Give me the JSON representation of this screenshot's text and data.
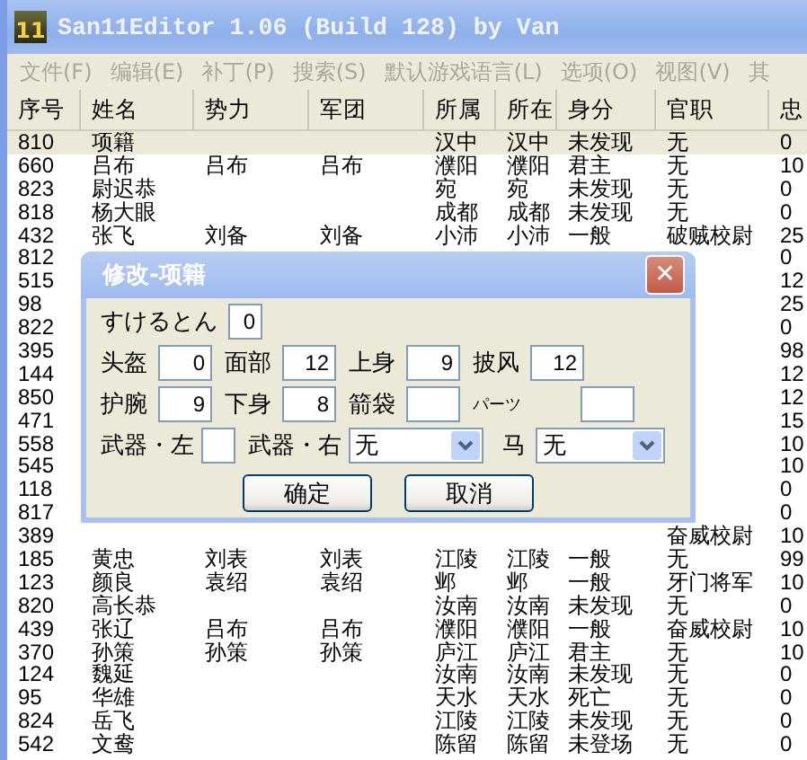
{
  "window": {
    "icon_label": "11",
    "title": "San11Editor 1.06 (Build 128) by Van"
  },
  "menu": [
    {
      "label": "文件(F)",
      "disabled": true
    },
    {
      "label": "编辑(E)",
      "disabled": true
    },
    {
      "label": "补丁(P)",
      "disabled": true
    },
    {
      "label": "搜索(S)",
      "disabled": true
    },
    {
      "label": "默认游戏语言(L)",
      "disabled": true
    },
    {
      "label": "选项(O)",
      "disabled": true
    },
    {
      "label": "视图(V)",
      "disabled": true
    },
    {
      "label": "其",
      "disabled": true
    }
  ],
  "table": {
    "columns": [
      "序号",
      "姓名",
      "势力",
      "军团",
      "所属",
      "所在",
      "身分",
      "官职",
      "忠"
    ],
    "rows": [
      {
        "selected": true,
        "id": "810",
        "name": "项籍",
        "belongs": "汉中",
        "location": "汉中",
        "status": "未发现",
        "rank": "无",
        "loyalty": "0"
      },
      {
        "selected": false,
        "id": "660",
        "name": "吕布",
        "faction": "吕布",
        "corps": "吕布",
        "belongs": "濮阳",
        "location": "濮阳",
        "status": "君主",
        "rank": "无",
        "loyalty": "10"
      },
      {
        "selected": false,
        "id": "823",
        "name": "尉迟恭",
        "belongs": "宛",
        "location": "宛",
        "status": "未发现",
        "rank": "无",
        "loyalty": "0"
      },
      {
        "selected": false,
        "id": "818",
        "name": "杨大眼",
        "belongs": "成都",
        "location": "成都",
        "status": "未发现",
        "rank": "无",
        "loyalty": "0"
      },
      {
        "selected": false,
        "id": "432",
        "name": "张飞",
        "faction": "刘备",
        "corps": "刘备",
        "belongs": "小沛",
        "location": "小沛",
        "status": "一般",
        "rank": "破贼校尉",
        "loyalty": "25"
      },
      {
        "selected": false,
        "id": "812",
        "loyalty": "0"
      },
      {
        "selected": false,
        "id": "515",
        "loyalty": "12"
      },
      {
        "selected": false,
        "id": "98",
        "loyalty": "25"
      },
      {
        "selected": false,
        "id": "822",
        "loyalty": "0"
      },
      {
        "selected": false,
        "id": "395",
        "loyalty": "98"
      },
      {
        "selected": false,
        "id": "144",
        "loyalty": "12"
      },
      {
        "selected": false,
        "id": "850",
        "loyalty": "12"
      },
      {
        "selected": false,
        "id": "471",
        "loyalty": "15"
      },
      {
        "selected": false,
        "id": "558",
        "loyalty": "10"
      },
      {
        "selected": false,
        "id": "545",
        "loyalty": "10"
      },
      {
        "selected": false,
        "id": "118",
        "loyalty": "0"
      },
      {
        "selected": false,
        "id": "817",
        "loyalty": "0"
      },
      {
        "selected": false,
        "id": "389",
        "rank": "奋威校尉",
        "loyalty": "10"
      },
      {
        "selected": false,
        "id": "185",
        "name": "黄忠",
        "faction": "刘表",
        "corps": "刘表",
        "belongs": "江陵",
        "location": "江陵",
        "status": "一般",
        "rank": "无",
        "loyalty": "99"
      },
      {
        "selected": false,
        "id": "123",
        "name": "颜良",
        "faction": "袁绍",
        "corps": "袁绍",
        "belongs": "邺",
        "location": "邺",
        "status": "一般",
        "rank": "牙门将军",
        "loyalty": "10"
      },
      {
        "selected": false,
        "id": "820",
        "name": "高长恭",
        "belongs": "汝南",
        "location": "汝南",
        "status": "未发现",
        "rank": "无",
        "loyalty": "0"
      },
      {
        "selected": false,
        "id": "439",
        "name": "张辽",
        "faction": "吕布",
        "corps": "吕布",
        "belongs": "濮阳",
        "location": "濮阳",
        "status": "一般",
        "rank": "奋威校尉",
        "loyalty": "10"
      },
      {
        "selected": false,
        "id": "370",
        "name": "孙策",
        "faction": "孙策",
        "corps": "孙策",
        "belongs": "庐江",
        "location": "庐江",
        "status": "君主",
        "rank": "无",
        "loyalty": "10"
      },
      {
        "selected": false,
        "id": "124",
        "name": "魏延",
        "belongs": "汝南",
        "location": "汝南",
        "status": "未发现",
        "rank": "无",
        "loyalty": "0"
      },
      {
        "selected": false,
        "id": "95",
        "name": "华雄",
        "belongs": "天水",
        "location": "天水",
        "status": "死亡",
        "rank": "无",
        "loyalty": "0"
      },
      {
        "selected": false,
        "id": "824",
        "name": "岳飞",
        "belongs": "江陵",
        "location": "江陵",
        "status": "未发现",
        "rank": "无",
        "loyalty": "0"
      },
      {
        "selected": false,
        "id": "542",
        "name": "文鸯",
        "belongs": "陈留",
        "location": "陈留",
        "status": "未登场",
        "rank": "无",
        "loyalty": "0"
      }
    ]
  },
  "dialog": {
    "title": "修改-项籍",
    "close": "✕",
    "rows": [
      [
        {
          "kind": "short",
          "label": "すけるとん",
          "value": "0"
        }
      ],
      [
        {
          "kind": "number",
          "label": "头盔",
          "value": "0"
        },
        {
          "kind": "number",
          "label": "面部",
          "value": "12"
        },
        {
          "kind": "number",
          "label": "上身",
          "value": "9"
        },
        {
          "kind": "number",
          "label": "披风",
          "value": "12"
        }
      ],
      [
        {
          "kind": "number",
          "label": "护腕",
          "value": "9"
        },
        {
          "kind": "number",
          "label": "下身",
          "value": "8"
        },
        {
          "kind": "number",
          "label": "箭袋"
        },
        {
          "kind": "small_number",
          "label": "パーツ"
        }
      ],
      [
        {
          "kind": "short",
          "label": "武器・左"
        },
        {
          "kind": "select",
          "label": "武器・右",
          "value": "无"
        },
        {
          "kind": "select",
          "label": "马",
          "value": "无"
        }
      ]
    ],
    "buttons": [
      "确定",
      "取消"
    ]
  }
}
